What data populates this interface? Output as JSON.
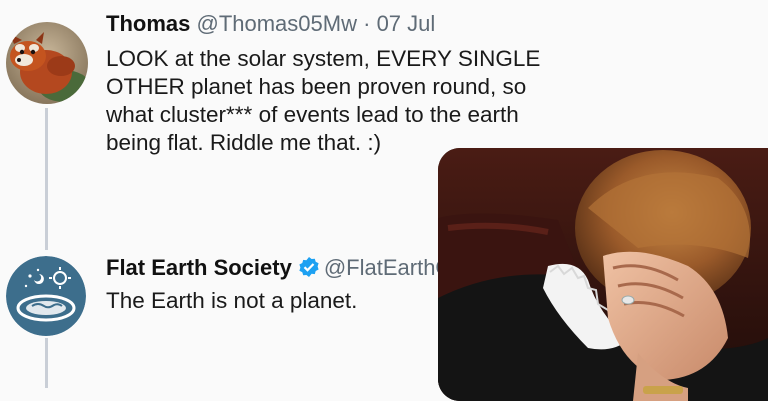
{
  "tweets": [
    {
      "display_name": "Thomas",
      "handle": "@Thomas05Mw",
      "separator": "·",
      "date": "07 Jul",
      "lines": [
        "LOOK at the solar system, EVERY SINGLE",
        "OTHER planet has been proven round, so",
        "what cluster*** of events lead to the earth",
        "being flat. Riddle me that. :)"
      ],
      "avatar_icon": "red-panda-avatar-icon"
    },
    {
      "display_name": "Flat Earth Society",
      "verified_icon": "verified-badge-icon",
      "handle": "@FlatEarthOrg",
      "lines": [
        "The Earth is not a planet."
      ],
      "avatar_icon": "flat-earth-map-avatar-icon"
    }
  ],
  "overlay": {
    "image_icon": "facepalm-reaction-image"
  },
  "colors": {
    "background": "#fafafa",
    "thread_line": "#c9ced6",
    "handle": "#5f6b76",
    "verified": "#1da1f2",
    "flat_earth_avatar": "#3d6e8c"
  }
}
